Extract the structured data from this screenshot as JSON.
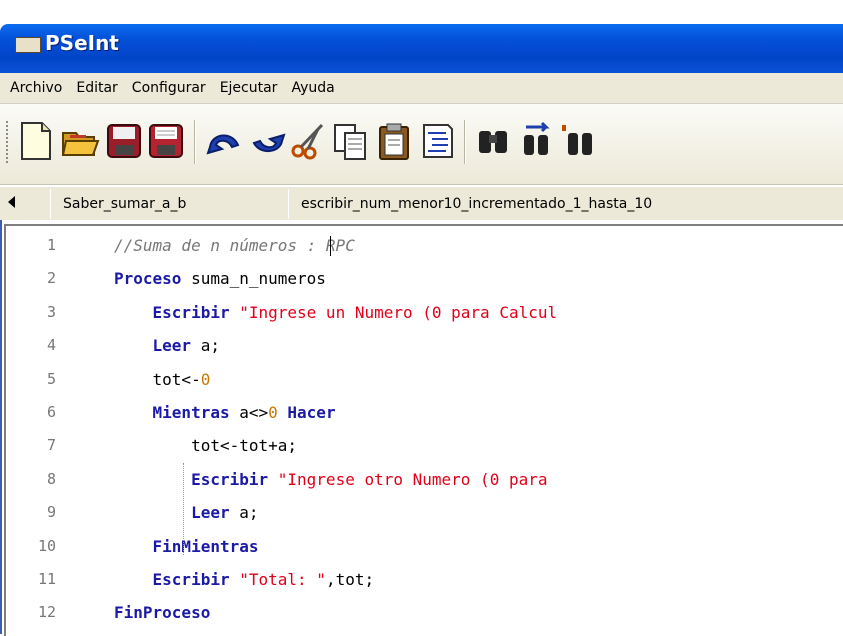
{
  "window": {
    "title": "PSeInt"
  },
  "menu": [
    "Archivo",
    "Editar",
    "Configurar",
    "Ejecutar",
    "Ayuda"
  ],
  "toolbar": {
    "buttons": [
      "new-file-icon",
      "open-folder-icon",
      "save-icon",
      "save-as-icon",
      "undo-icon",
      "redo-icon",
      "cut-icon",
      "copy-icon",
      "paste-icon",
      "indent-icon",
      "find-icon",
      "find-next-icon",
      "replace-icon"
    ]
  },
  "tabs": [
    "Saber_sumar_a_b",
    "escribir_num_menor10_incrementado_1_hasta_10"
  ],
  "editor": {
    "lines": [
      {
        "n": "1",
        "indent": "",
        "parts": [
          {
            "t": "//Suma de n números : RPC",
            "c": "cmt"
          }
        ]
      },
      {
        "n": "2",
        "indent": "",
        "parts": [
          {
            "t": "Proceso",
            "c": "kw"
          },
          {
            "t": " suma_n_numeros",
            "c": "txt"
          }
        ]
      },
      {
        "n": "3",
        "indent": "    ",
        "parts": [
          {
            "t": "Escribir",
            "c": "kw"
          },
          {
            "t": " ",
            "c": "txt"
          },
          {
            "t": "\"Ingrese un Numero (0 para Calcul",
            "c": "str"
          }
        ]
      },
      {
        "n": "4",
        "indent": "    ",
        "parts": [
          {
            "t": "Leer",
            "c": "kw"
          },
          {
            "t": " a;",
            "c": "txt"
          }
        ]
      },
      {
        "n": "5",
        "indent": "    ",
        "parts": [
          {
            "t": "tot<-",
            "c": "txt"
          },
          {
            "t": "0",
            "c": "num"
          }
        ]
      },
      {
        "n": "6",
        "indent": "    ",
        "parts": [
          {
            "t": "Mientras",
            "c": "kw"
          },
          {
            "t": " a<>",
            "c": "txt"
          },
          {
            "t": "0",
            "c": "num"
          },
          {
            "t": " ",
            "c": "txt"
          },
          {
            "t": "Hacer",
            "c": "kw"
          }
        ]
      },
      {
        "n": "7",
        "indent": "        ",
        "parts": [
          {
            "t": "tot<-tot+a;",
            "c": "txt"
          }
        ]
      },
      {
        "n": "8",
        "indent": "        ",
        "parts": [
          {
            "t": "Escribir",
            "c": "kw"
          },
          {
            "t": " ",
            "c": "txt"
          },
          {
            "t": "\"Ingrese otro Numero (0 para",
            "c": "str"
          }
        ]
      },
      {
        "n": "9",
        "indent": "        ",
        "parts": [
          {
            "t": "Leer",
            "c": "kw"
          },
          {
            "t": " a;",
            "c": "txt"
          }
        ]
      },
      {
        "n": "10",
        "indent": "    ",
        "parts": [
          {
            "t": "FinMientras",
            "c": "kw"
          }
        ]
      },
      {
        "n": "11",
        "indent": "    ",
        "parts": [
          {
            "t": "Escribir",
            "c": "kw"
          },
          {
            "t": " ",
            "c": "txt"
          },
          {
            "t": "\"Total: \"",
            "c": "str"
          },
          {
            "t": ",tot;",
            "c": "txt"
          }
        ]
      },
      {
        "n": "12",
        "indent": "",
        "parts": [
          {
            "t": "FinProceso",
            "c": "kw"
          }
        ]
      }
    ]
  }
}
